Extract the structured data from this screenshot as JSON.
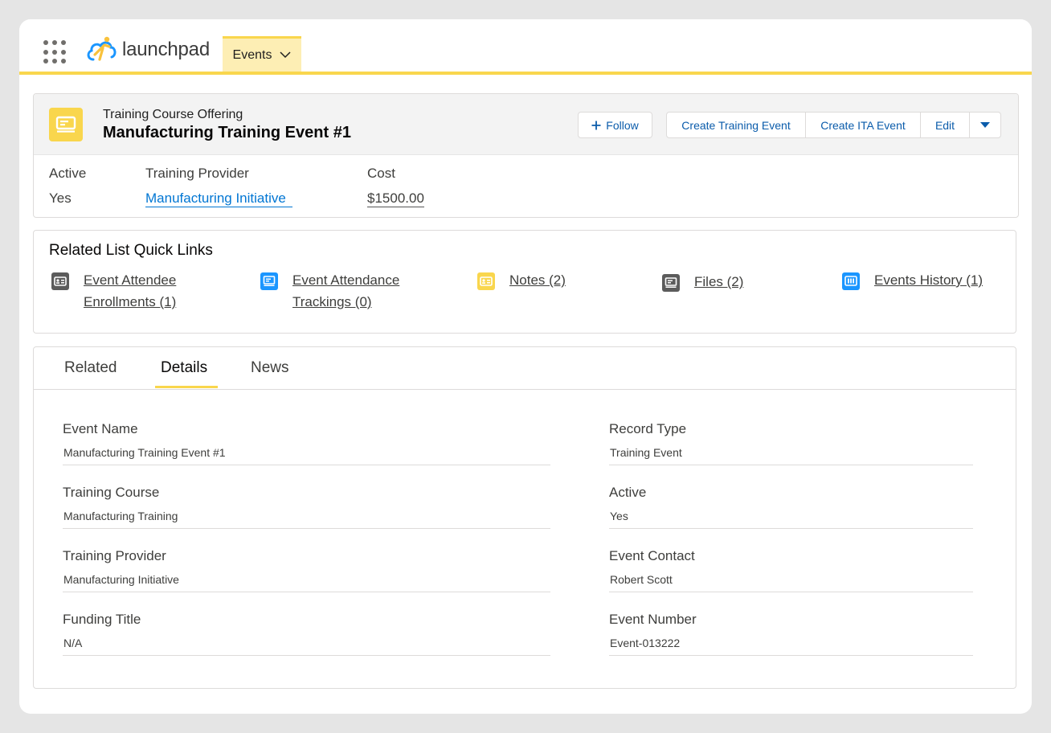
{
  "app": {
    "logo_text": "launchpad",
    "nav_tab": "Events"
  },
  "colors": {
    "accent_yellow": "#f9d64d",
    "link_blue": "#0176d3",
    "button_blue": "#0b5cab",
    "icon_blue": "#1b96ff",
    "icon_gray": "#5c5c5c"
  },
  "record": {
    "object_type": "Training Course Offering",
    "title": "Manufacturing Training Event #1",
    "actions": {
      "follow": "Follow",
      "create_training_event": "Create Training Event",
      "create_ita_event": "Create ITA Event",
      "edit": "Edit"
    },
    "highlights": [
      {
        "label": "Active",
        "value": "Yes"
      },
      {
        "label": "Training Provider",
        "value": "Manufacturing Initiative"
      },
      {
        "label": "Cost",
        "value": "$1500.00"
      }
    ]
  },
  "quick_links": {
    "title": "Related List Quick Links",
    "items": [
      {
        "line1": "Event Attendee",
        "line2": "Enrollments (1)",
        "icon": "contact-card-icon"
      },
      {
        "line1": "Event Attendance",
        "line2": "Trackings (0)",
        "icon": "record-icon"
      },
      {
        "line1": "Notes (2)",
        "line2": "",
        "icon": "note-icon"
      },
      {
        "line1": "Files (2)",
        "line2": "",
        "icon": "file-icon"
      },
      {
        "line1": "Events History (1)",
        "line2": "",
        "icon": "history-icon"
      }
    ]
  },
  "tabs": [
    "Related",
    "Details",
    "News"
  ],
  "details": {
    "left": [
      {
        "label": "Event Name",
        "value": "Manufacturing Training Event #1"
      },
      {
        "label": "Training Course",
        "value": "Manufacturing Training"
      },
      {
        "label": "Training Provider",
        "value": "Manufacturing Initiative"
      },
      {
        "label": "Funding Title",
        "value": "N/A"
      }
    ],
    "right": [
      {
        "label": "Record Type",
        "value": "Training Event"
      },
      {
        "label": "Active",
        "value": "Yes"
      },
      {
        "label": "Event Contact",
        "value": "Robert Scott"
      },
      {
        "label": "Event Number",
        "value": "Event-013222"
      }
    ]
  }
}
